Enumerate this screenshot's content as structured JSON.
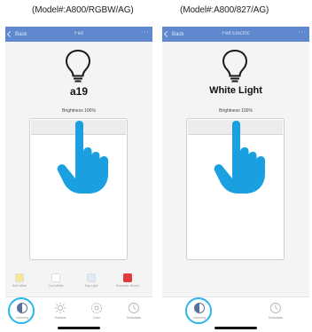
{
  "captions": {
    "left": "(Model#:A800/RGBW/AG)",
    "right": "(Model#:A800/827/AG)"
  },
  "left_screen": {
    "nav": {
      "back_label": "Back",
      "title": "Feit",
      "more": "···"
    },
    "device_icon": "lightbulb-icon",
    "device_name": "a19",
    "brightness_text": "Brightness 100%",
    "brightness_percent": 100,
    "scenes": [
      {
        "label": "Soft White",
        "color": "#f6e79a"
      },
      {
        "label": "Cool White",
        "color": "#ffffff"
      },
      {
        "label": "Day Light",
        "color": "#dfe9f7"
      },
      {
        "label": "Romantic Dinner",
        "color": "#e23a3a"
      }
    ],
    "tabs": [
      {
        "label": "Dimming",
        "icon": "dimming-icon",
        "active": true
      },
      {
        "label": "Sunsets",
        "icon": "sun-icon",
        "active": false
      },
      {
        "label": "Color",
        "icon": "color-wheel-icon",
        "active": false
      },
      {
        "label": "Schedules",
        "icon": "clock-icon",
        "active": false
      }
    ]
  },
  "right_screen": {
    "nav": {
      "back_label": "Back",
      "title": "Feit Electric",
      "more": "···"
    },
    "device_icon": "lightbulb-icon",
    "device_name": "White Light",
    "brightness_text": "Brightness 100%",
    "brightness_percent": 100,
    "tabs": [
      {
        "label": "Dimming",
        "icon": "dimming-icon",
        "active": true
      },
      {
        "label": "Schedules",
        "icon": "clock-icon",
        "active": false
      }
    ]
  },
  "colors": {
    "nav_bar": "#5f88cf",
    "highlight": "#27b6ea",
    "hand": "#1aa0e0"
  }
}
